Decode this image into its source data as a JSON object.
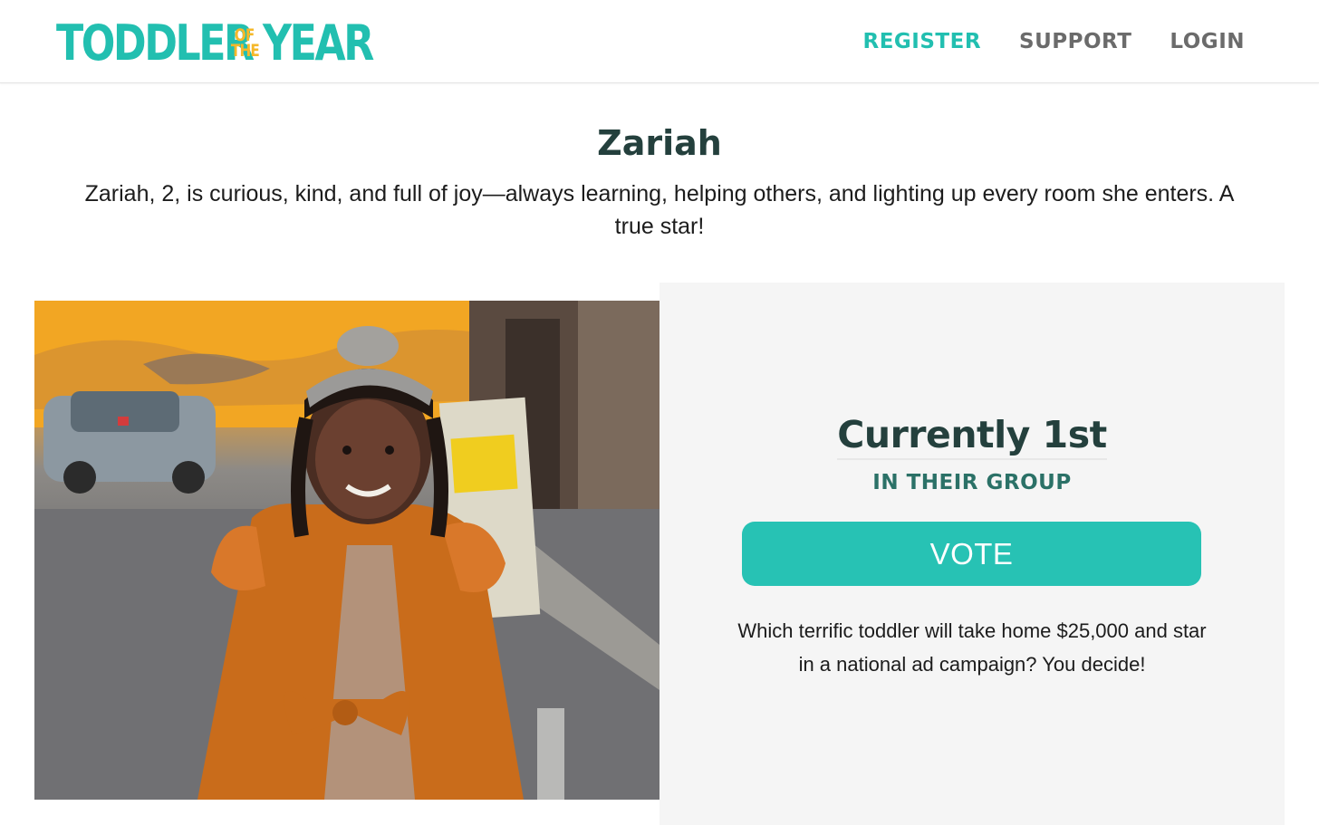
{
  "brand": {
    "logo_part1": "TODDLER",
    "logo_of": "OF",
    "logo_the": "THE",
    "logo_part2": "YEAR",
    "primary_color": "#22bfb0",
    "accent_color": "#f5b82a"
  },
  "nav": {
    "items": [
      {
        "label": "REGISTER",
        "active": true
      },
      {
        "label": "SUPPORT",
        "active": false
      },
      {
        "label": "LOGIN",
        "active": false
      }
    ]
  },
  "profile": {
    "name": "Zariah",
    "bio": "Zariah, 2, is curious, kind, and full of joy—always learning, helping others, and lighting up every room she enters. A true star!"
  },
  "ranking": {
    "title": "Currently 1st",
    "subtitle": "IN THEIR GROUP"
  },
  "vote": {
    "button_label": "VOTE",
    "button_color": "#27c2b4"
  },
  "blurb": "Which terrific toddler will take home $25,000 and star in a national ad campaign? You decide!"
}
